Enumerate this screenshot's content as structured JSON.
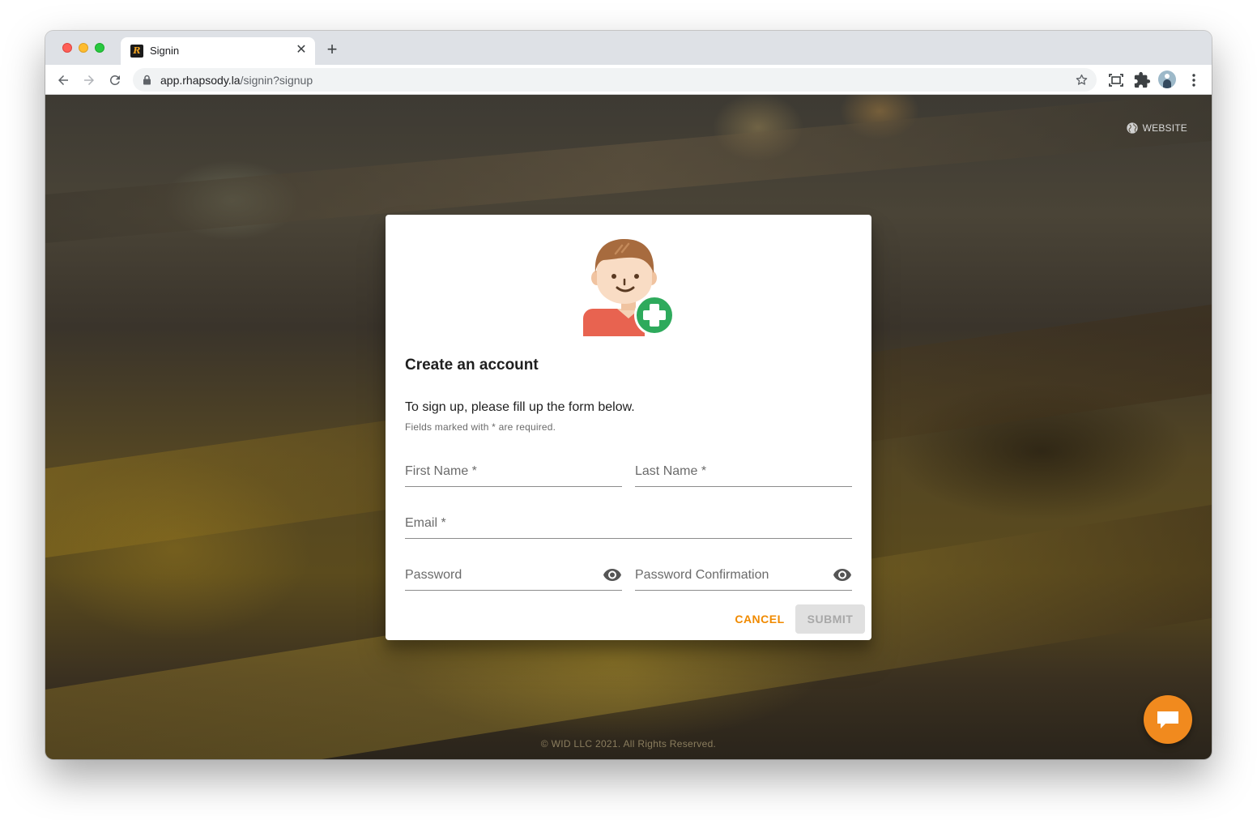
{
  "browser": {
    "tab_title": "Signin",
    "url_host": "app.rhapsody.la",
    "url_path": "/signin?signup",
    "new_tab_label": "+",
    "tab_close_label": "✕"
  },
  "page": {
    "website_link": "WEBSITE",
    "footer": "© WID LLC 2021. All Rights Reserved."
  },
  "dialog": {
    "title": "Create an account",
    "description": "To sign up, please fill up the form below.",
    "required_note": "Fields marked with * are required.",
    "fields": {
      "first_name": {
        "placeholder": "First Name *",
        "value": ""
      },
      "last_name": {
        "placeholder": "Last Name *",
        "value": ""
      },
      "email": {
        "placeholder": "Email *",
        "value": ""
      },
      "password": {
        "placeholder": "Password",
        "value": ""
      },
      "password_confirmation": {
        "placeholder": "Password Confirmation",
        "value": ""
      }
    },
    "cancel_label": "CANCEL",
    "submit_label": "SUBMIT"
  },
  "icons": {
    "back": "arrow-left-icon",
    "forward": "arrow-right-icon",
    "reload": "reload-icon",
    "lock": "lock-icon",
    "bookmark": "star-icon",
    "screen_capture": "screen-capture-icon",
    "extensions": "puzzle-icon",
    "menu": "more-vertical-icon",
    "website": "globe-icon",
    "password_toggle": "eye-icon",
    "chat": "chat-bubble-icon"
  },
  "colors": {
    "accent": "#f08a00",
    "chat_fab": "#f18a1e",
    "add_badge": "#2eaa5c",
    "submit_disabled_bg": "#e0e0e0"
  }
}
